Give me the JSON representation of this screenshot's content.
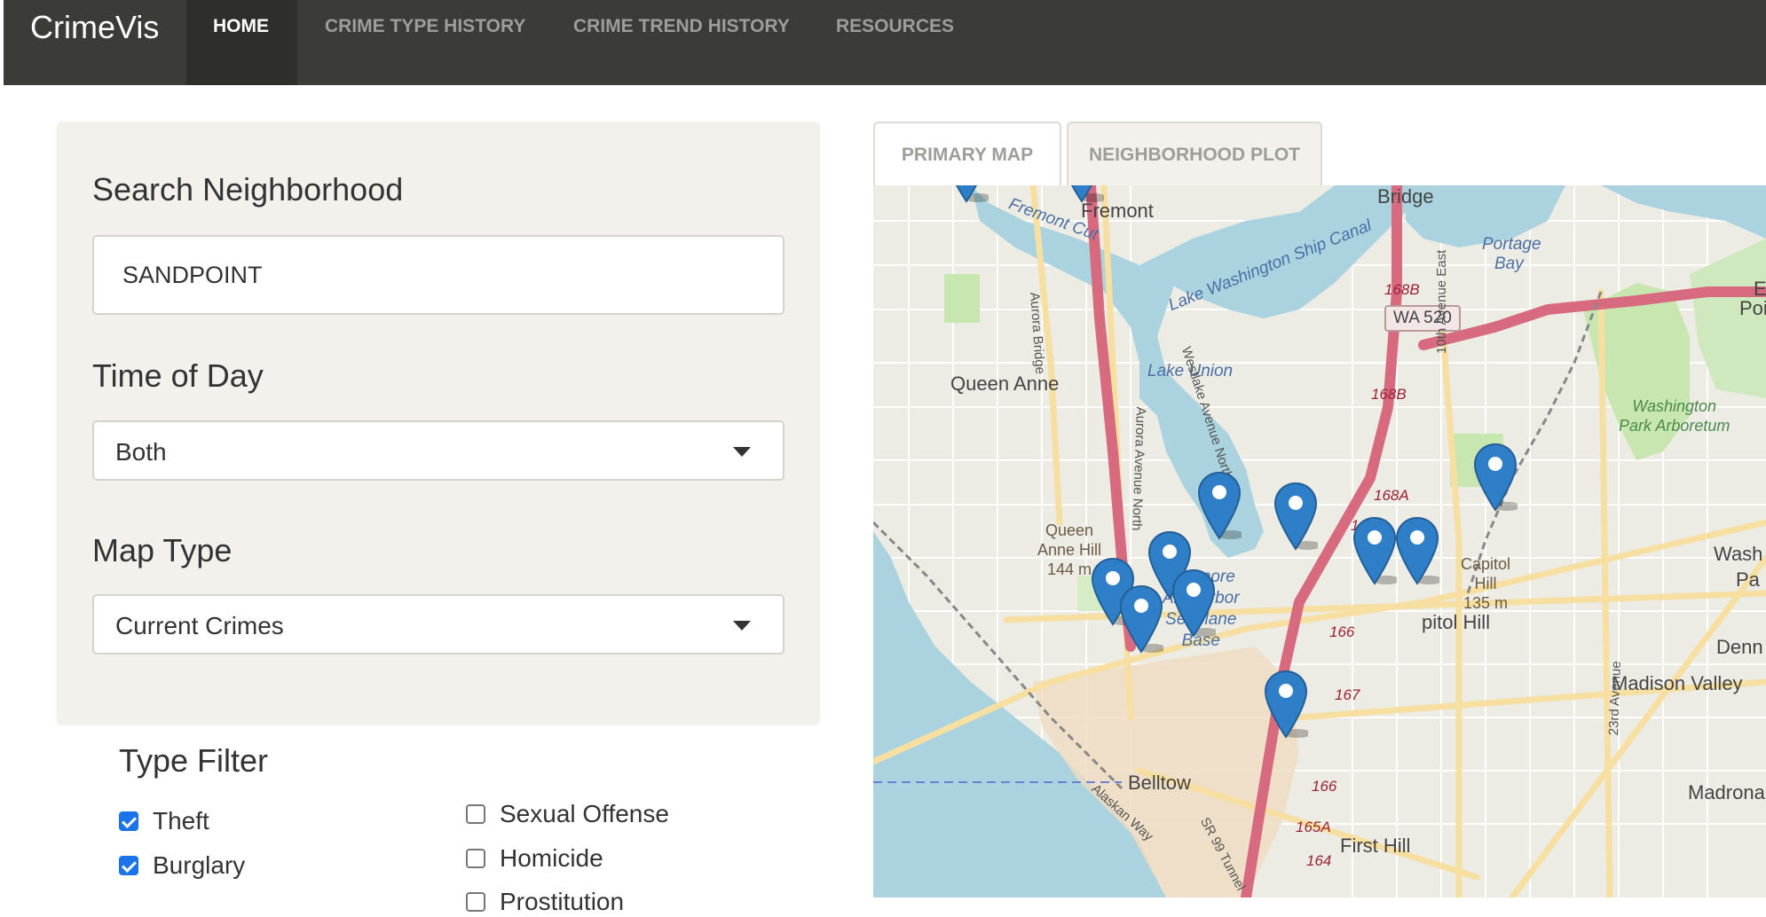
{
  "navbar": {
    "brand": "CrimeVis",
    "items": [
      {
        "label": "HOME",
        "active": true
      },
      {
        "label": "CRIME TYPE HISTORY",
        "active": false
      },
      {
        "label": "CRIME TREND HISTORY",
        "active": false
      },
      {
        "label": "RESOURCES",
        "active": false
      }
    ]
  },
  "sidebar": {
    "search": {
      "label": "Search Neighborhood",
      "value": "SANDPOINT"
    },
    "time_of_day": {
      "label": "Time of Day",
      "selected": "Both"
    },
    "map_type": {
      "label": "Map Type",
      "selected": "Current Crimes"
    },
    "type_filter": {
      "label": "Type Filter",
      "options": [
        {
          "label": "Theft",
          "checked": true
        },
        {
          "label": "Burglary",
          "checked": true
        },
        {
          "label": "Sexual Offense",
          "checked": false
        },
        {
          "label": "Homicide",
          "checked": false
        },
        {
          "label": "Prostitution",
          "checked": false
        }
      ]
    }
  },
  "tabs": [
    {
      "label": "PRIMARY MAP",
      "active": true
    },
    {
      "label": "NEIGHBORHOOD PLOT",
      "active": false
    }
  ],
  "map": {
    "labels": {
      "fremont": "Fremont",
      "bridge": "Bridge",
      "queen_anne": "Queen Anne",
      "queen_anne_hill_1": "Queen",
      "queen_anne_hill_2": "Anne Hill",
      "queen_anne_hill_3": "144 m",
      "capitol_hill_peak_1": "Capitol",
      "capitol_hill_peak_2": "Hill",
      "capitol_hill_peak_3": "135 m",
      "capitol_hill": "pitol Hill",
      "belltown": "Belltow",
      "first_hill": "First Hill",
      "madison_valley": "Madison Valley",
      "madrona": "Madrona",
      "denny": "Denn",
      "washington": "Wash",
      "pa": "Pa",
      "e_edge": "E",
      "poi_edge": "Poi",
      "lake_union": "Lake Union",
      "ship_canal": "Lake Washington Ship Canal",
      "fremont_cut": "Fremont Cut",
      "portage_bay_1": "Portage",
      "portage_bay_2": "Bay",
      "arboretum_1": "Washington",
      "arboretum_2": "Park Arboretum",
      "kenmore_1": "Kenmore",
      "kenmore_2": "Air Harbor",
      "kenmore_3": "Seaplane",
      "kenmore_4": "Base",
      "wa520": "WA 520",
      "exit_168b_1": "168B",
      "exit_168b_2": "168B",
      "exit_168a": "168A",
      "exit_167_1": "167",
      "exit_167_2": "167",
      "exit_166_1": "166",
      "exit_166_2": "166",
      "exit_165a": "165A",
      "exit_164": "164",
      "aurora_bridge": "Aurora Bridge",
      "westlake": "Westlake Avenue North",
      "aurora_ave": "Aurora Avenue North",
      "tenth_ave": "10th Avenue East",
      "alaskan_way": "Alaskan Way",
      "sr99": "SR 99 Tunnel",
      "twentythird": "23rd Avenue"
    },
    "markers": [
      {
        "name": "marker-1"
      },
      {
        "name": "marker-2"
      },
      {
        "name": "marker-3"
      },
      {
        "name": "marker-4"
      },
      {
        "name": "marker-5"
      },
      {
        "name": "marker-6"
      },
      {
        "name": "marker-7"
      },
      {
        "name": "marker-8"
      },
      {
        "name": "marker-9"
      },
      {
        "name": "marker-10"
      }
    ],
    "marker_color": "#2f7fc8"
  },
  "colors": {
    "navbar_bg": "#3b3c37",
    "sidebar_bg": "#f4f1ed",
    "checkbox_checked": "#1a73e8",
    "water": "#aad3df",
    "park": "#c8e6b0",
    "motorway": "#d76a7f",
    "primary_road": "#f6dfa0"
  }
}
